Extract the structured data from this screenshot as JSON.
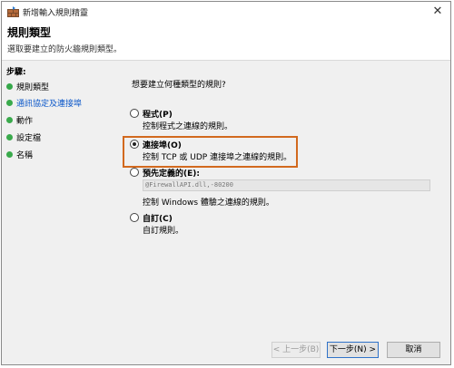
{
  "window": {
    "title": "新增輸入規則精靈",
    "close_glyph": "✕"
  },
  "header": {
    "title": "規則類型",
    "subtitle": "選取要建立的防火牆規則類型。"
  },
  "sidebar": {
    "heading": "步驟:",
    "steps": [
      {
        "label": "規則類型",
        "state": "done"
      },
      {
        "label": "通訊協定及連接埠",
        "state": "current"
      },
      {
        "label": "動作",
        "state": "pending"
      },
      {
        "label": "設定檔",
        "state": "pending"
      },
      {
        "label": "名稱",
        "state": "pending"
      }
    ]
  },
  "main": {
    "question": "想要建立何種類型的規則?",
    "options": [
      {
        "label": "程式(P)",
        "description": "控制程式之連線的規則。",
        "selected": false
      },
      {
        "label": "連接埠(O)",
        "description": "控制 TCP 或 UDP 連接埠之連線的規則。",
        "selected": true
      },
      {
        "label": "預先定義的(E):",
        "description": "控制 Windows 體驗之連線的規則。",
        "selected": false,
        "field_value": "@FirewallAPI.dll,-80200"
      },
      {
        "label": "自訂(C)",
        "description": "自訂規則。",
        "selected": false
      }
    ]
  },
  "buttons": {
    "back": "< 上一步(B)",
    "next": "下一步(N) >",
    "cancel": "取消"
  },
  "colors": {
    "highlight": "#d2691e",
    "link": "#0b57c9",
    "step_dot": "#36a84a"
  }
}
